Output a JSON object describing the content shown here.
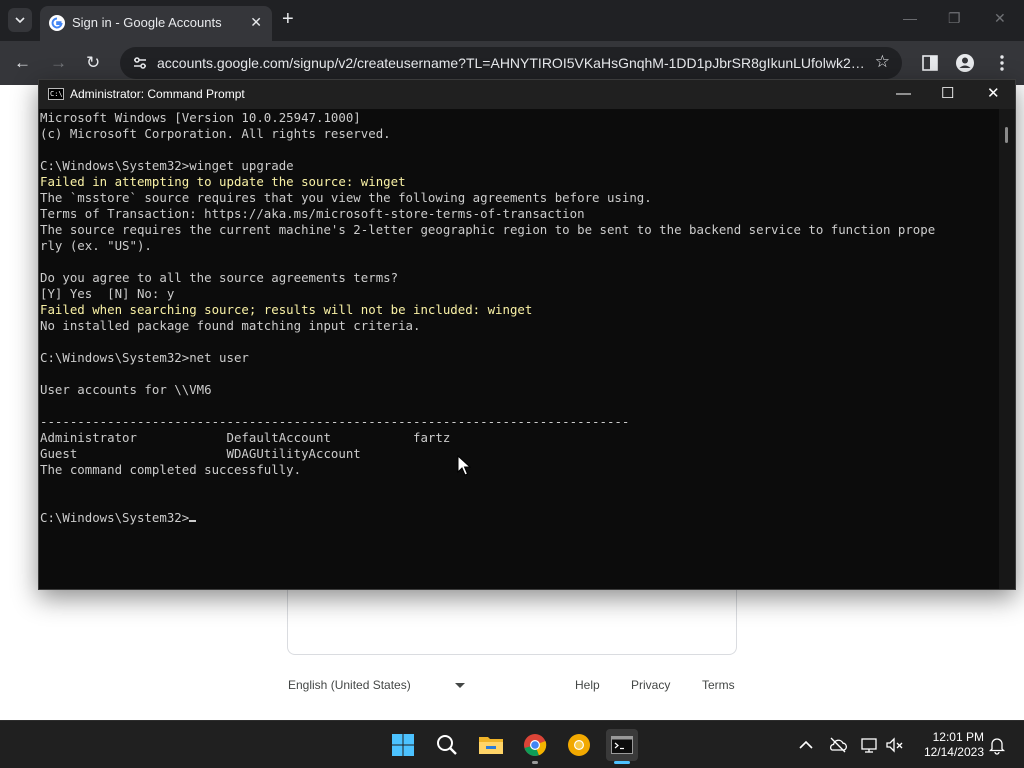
{
  "browser": {
    "tab": {
      "title": "Sign in - Google Accounts"
    },
    "address_bar": {
      "url": "accounts.google.com/signup/v2/createusername?TL=AHNYTIROI5VKaHsGnqhM-1DD1pJbrSR8gIkunLUfolwk2PC..."
    },
    "page_footer": {
      "language": "English (United States)",
      "help": "Help",
      "privacy": "Privacy",
      "terms": "Terms"
    }
  },
  "cmd": {
    "title": "Administrator: Command Prompt",
    "icon_label": "C:\\",
    "lines": [
      {
        "text": "Microsoft Windows [Version 10.0.25947.1000]",
        "style": "normal"
      },
      {
        "text": "(c) Microsoft Corporation. All rights reserved.",
        "style": "normal"
      },
      {
        "text": "",
        "style": "normal"
      },
      {
        "text": "C:\\Windows\\System32>winget upgrade",
        "style": "normal"
      },
      {
        "text": "Failed in attempting to update the source: winget",
        "style": "warn"
      },
      {
        "text": "The `msstore` source requires that you view the following agreements before using.",
        "style": "normal"
      },
      {
        "text": "Terms of Transaction: https://aka.ms/microsoft-store-terms-of-transaction",
        "style": "normal"
      },
      {
        "text": "The source requires the current machine's 2-letter geographic region to be sent to the backend service to function prope",
        "style": "normal"
      },
      {
        "text": "rly (ex. \"US\").",
        "style": "normal"
      },
      {
        "text": "",
        "style": "normal"
      },
      {
        "text": "Do you agree to all the source agreements terms?",
        "style": "normal"
      },
      {
        "text": "[Y] Yes  [N] No: y",
        "style": "normal"
      },
      {
        "text": "Failed when searching source; results will not be included: winget",
        "style": "warn"
      },
      {
        "text": "No installed package found matching input criteria.",
        "style": "normal"
      },
      {
        "text": "",
        "style": "normal"
      },
      {
        "text": "C:\\Windows\\System32>net user",
        "style": "normal"
      },
      {
        "text": "",
        "style": "normal"
      },
      {
        "text": "User accounts for \\\\VM6",
        "style": "normal"
      },
      {
        "text": "",
        "style": "normal"
      },
      {
        "text": "-------------------------------------------------------------------------------",
        "style": "normal"
      },
      {
        "text": "Administrator            DefaultAccount           fartz",
        "style": "normal"
      },
      {
        "text": "Guest                    WDAGUtilityAccount",
        "style": "normal"
      },
      {
        "text": "The command completed successfully.",
        "style": "normal"
      },
      {
        "text": "",
        "style": "normal"
      },
      {
        "text": "",
        "style": "normal"
      }
    ],
    "prompt": "C:\\Windows\\System32>"
  },
  "taskbar": {
    "apps": [
      "start-icon",
      "search-icon",
      "file-explorer-icon",
      "chrome-icon",
      "chrome-canary-icon",
      "terminal-icon"
    ],
    "clock": {
      "time": "12:01 PM",
      "date": "12/14/2023"
    }
  },
  "colors": {
    "terminal_bg": "#0c0c0c",
    "terminal_text": "#cccccc",
    "terminal_warn": "#f9f1a5",
    "chrome_dark": "#202124",
    "taskbar_accent": "#4cc2ff"
  }
}
